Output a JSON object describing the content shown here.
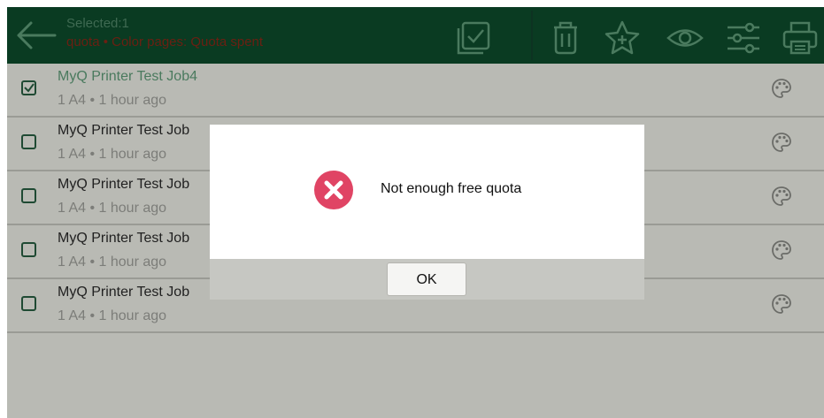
{
  "header": {
    "back_icon": "arrow-left-icon",
    "selected_label": "Selected:1",
    "subtitle": "quota • Color pages: Quota spent",
    "actions": [
      {
        "icon": "select-all-icon"
      },
      {
        "icon": "trash-icon"
      },
      {
        "icon": "star-icon"
      },
      {
        "icon": "eye-icon"
      },
      {
        "icon": "sliders-icon"
      },
      {
        "icon": "printer-icon"
      }
    ]
  },
  "jobs": [
    {
      "title": "MyQ Printer Test Job4",
      "meta": "1 A4 • 1 hour ago",
      "selected": true
    },
    {
      "title": "MyQ Printer Test Job",
      "meta": "1 A4 • 1 hour ago",
      "selected": false
    },
    {
      "title": "MyQ Printer Test Job",
      "meta": "1 A4 • 1 hour ago",
      "selected": false
    },
    {
      "title": "MyQ Printer Test Job",
      "meta": "1 A4 • 1 hour ago",
      "selected": false
    },
    {
      "title": "MyQ Printer Test Job",
      "meta": "1 A4 • 1 hour ago",
      "selected": false
    }
  ],
  "dialog": {
    "icon": "error-icon",
    "message": "Not enough free quota",
    "ok_label": "OK"
  },
  "colors": {
    "header_bg": "#0a3b22",
    "error": "#e04464"
  }
}
